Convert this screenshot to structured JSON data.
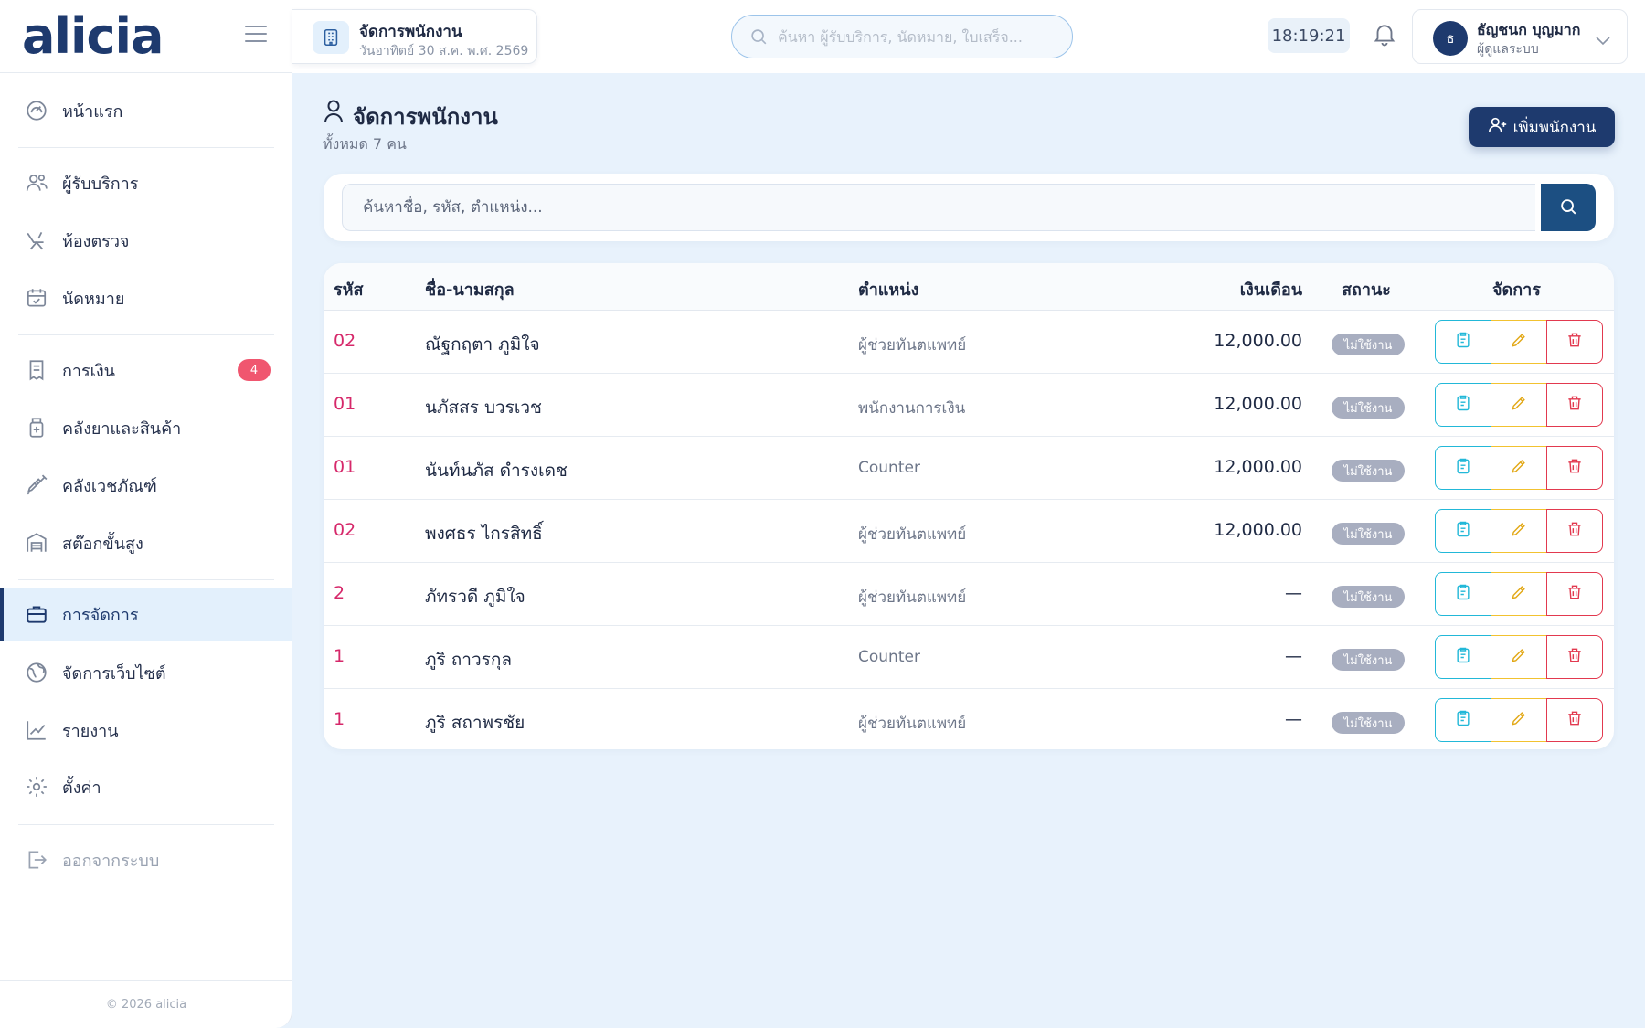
{
  "app": {
    "logo": "alicia",
    "footer": "© 2026 alicia"
  },
  "header": {
    "page_title": "จัดการพนักงาน",
    "date": "วันอาทิตย์ 30 ส.ค. พ.ศ. 2569",
    "search_placeholder": "ค้นหา ผู้รับบริการ, นัดหมาย, ใบเสร็จ...",
    "clock": "18:19:21",
    "user": {
      "initial": "ธ",
      "name": "ธัญชนก บุญมาก",
      "role": "ผู้ดูแลระบบ"
    }
  },
  "sidebar": {
    "items": [
      {
        "label": "หน้าแรก",
        "icon": "dashboard-icon"
      },
      {
        "label": "ผู้รับบริการ",
        "icon": "users-icon"
      },
      {
        "label": "ห้องตรวจ",
        "icon": "dental-chair-icon"
      },
      {
        "label": "นัดหมาย",
        "icon": "calendar-icon"
      },
      {
        "label": "การเงิน",
        "icon": "receipt-icon",
        "badge": "4"
      },
      {
        "label": "คลังยาและสินค้า",
        "icon": "medicine-icon"
      },
      {
        "label": "คลังเวชภัณฑ์",
        "icon": "syringe-icon"
      },
      {
        "label": "สต๊อกขั้นสูง",
        "icon": "warehouse-icon"
      },
      {
        "label": "การจัดการ",
        "icon": "briefcase-icon",
        "active": true
      },
      {
        "label": "จัดการเว็บไซต์",
        "icon": "globe-icon"
      },
      {
        "label": "รายงาน",
        "icon": "chart-icon"
      },
      {
        "label": "ตั้งค่า",
        "icon": "gear-icon"
      },
      {
        "label": "ออกจากระบบ",
        "icon": "logout-icon"
      }
    ]
  },
  "main": {
    "title": "จัดการพนักงาน",
    "subtitle": "ทั้งหมด 7 คน",
    "add_button": "เพิ่มพนักงาน",
    "search_placeholder": "ค้นหาชื่อ, รหัส, ตำแหน่ง...",
    "table": {
      "headers": [
        "รหัส",
        "ชื่อ-นามสกุล",
        "ตำแหน่ง",
        "เงินเดือน",
        "สถานะ",
        "จัดการ"
      ],
      "rows": [
        {
          "id": "02",
          "name": "ณัฐกฤตา ภูมิใจ",
          "position": "ผู้ช่วยทันตแพทย์",
          "salary": "12,000.00",
          "status": "ไม่ใช้งาน"
        },
        {
          "id": "01",
          "name": "นภัสสร บวรเวช",
          "position": "พนักงานการเงิน",
          "salary": "12,000.00",
          "status": "ไม่ใช้งาน"
        },
        {
          "id": "01",
          "name": "นันท์นภัส ดำรงเดช",
          "position": "Counter",
          "salary": "12,000.00",
          "status": "ไม่ใช้งาน"
        },
        {
          "id": "02",
          "name": "พงศธร ไกรสิทธิ์",
          "position": "ผู้ช่วยทันตแพทย์",
          "salary": "12,000.00",
          "status": "ไม่ใช้งาน"
        },
        {
          "id": "2",
          "name": "ภัทรวดี ภูมิใจ",
          "position": "ผู้ช่วยทันตแพทย์",
          "salary": "—",
          "status": "ไม่ใช้งาน"
        },
        {
          "id": "1",
          "name": "ภูริ ถาวรกุล",
          "position": "Counter",
          "salary": "—",
          "status": "ไม่ใช้งาน"
        },
        {
          "id": "1",
          "name": "ภูริ สถาพรชัย",
          "position": "ผู้ช่วยทันตแพทย์",
          "salary": "—",
          "status": "ไม่ใช้งาน"
        }
      ]
    }
  },
  "colors": {
    "primary": "#1e3a6e",
    "accent_id": "#d6286a",
    "view": "#22b8d8",
    "edit": "#f2c230",
    "delete": "#e2394f",
    "badge": "#f0566f"
  }
}
